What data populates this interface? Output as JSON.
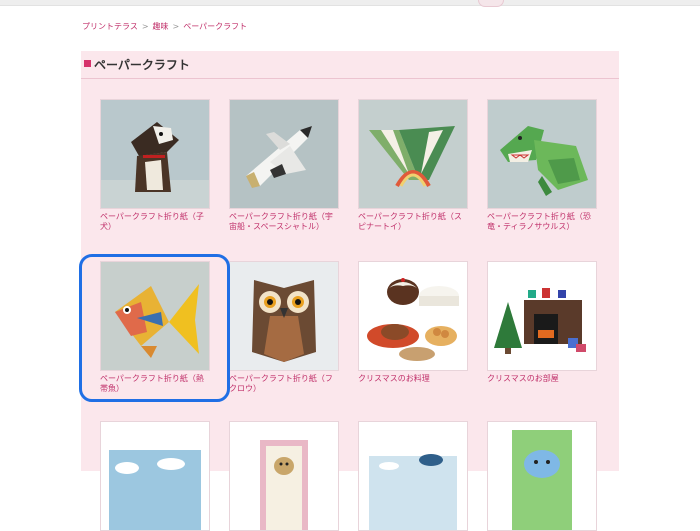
{
  "breadcrumb": {
    "items": [
      {
        "label": "プリントテラス"
      },
      {
        "label": "趣味"
      },
      {
        "label": "ペーパークラフト"
      }
    ],
    "separator": ">"
  },
  "section": {
    "title": "ペーパークラフト"
  },
  "items": [
    {
      "caption": "ペーパークラフト折り紙（子犬）",
      "icon": "puppy-origami-icon"
    },
    {
      "caption": "ペーパークラフト折り紙（宇宙船・スペースシャトル）",
      "icon": "space-shuttle-icon"
    },
    {
      "caption": "ペーパークラフト折り紙（スピナートイ）",
      "icon": "spinner-toy-icon"
    },
    {
      "caption": "ペーパークラフト折り紙（恐竜・ティラノサウルス）",
      "icon": "tyrannosaurus-icon"
    },
    {
      "caption": "ペーパークラフト折り紙（熱帯魚）",
      "icon": "tropical-fish-icon"
    },
    {
      "caption": "ペーパークラフト折り紙（フクロウ）",
      "icon": "owl-icon"
    },
    {
      "caption": "クリスマスのお料理",
      "icon": "christmas-food-icon"
    },
    {
      "caption": "クリスマスのお部屋",
      "icon": "christmas-room-icon"
    }
  ],
  "colors": {
    "link": "#c0306a",
    "panel": "#fbe7ec",
    "accent": "#d6336c",
    "highlight": "#1f6fe5"
  }
}
